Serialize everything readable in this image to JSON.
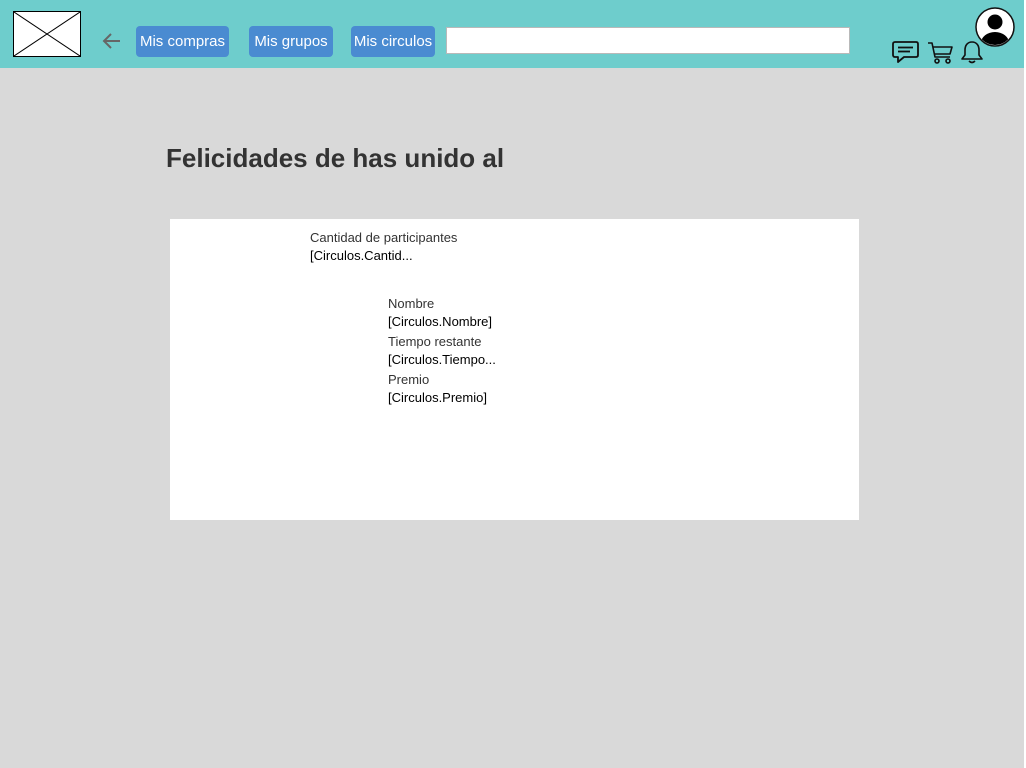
{
  "header": {
    "nav": {
      "compras": "Mis compras",
      "grupos": "Mis grupos",
      "circulos": "Mis circulos"
    },
    "search": {
      "value": "",
      "placeholder": ""
    },
    "icons": [
      "back-arrow-icon",
      "chat-icon",
      "cart-icon",
      "bell-icon",
      "avatar-icon",
      "logo-placeholder"
    ],
    "colors": {
      "bar": "#6ecdcc",
      "button": "#4a8bd1",
      "background": "#d9d9d9"
    }
  },
  "main": {
    "title": "Felicidades de has unido al",
    "card": {
      "participantes_label": "Cantidad de participantes",
      "participantes_value": "[Circulos.Cantid...",
      "nombre_label": "Nombre",
      "nombre_value": "[Circulos.Nombre]",
      "tiempo_label": "Tiempo restante",
      "tiempo_value": "[Circulos.Tiempo...",
      "premio_label": "Premio",
      "premio_value": "[Circulos.Premio]"
    }
  }
}
